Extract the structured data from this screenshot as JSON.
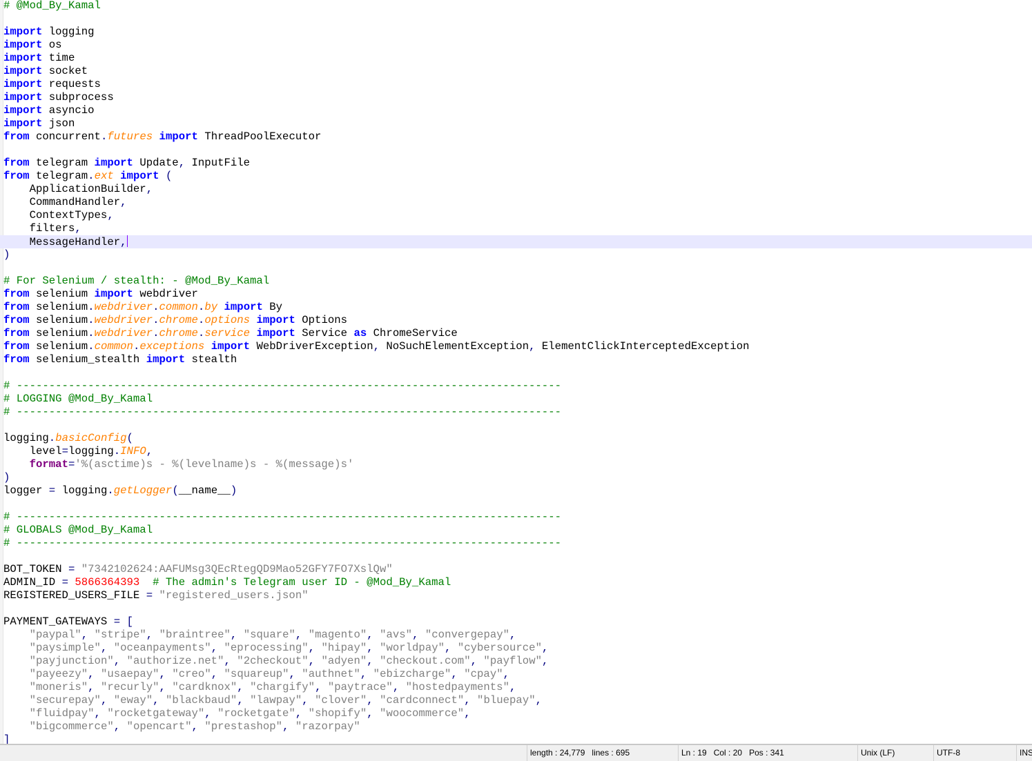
{
  "editor": {
    "current_line": 19,
    "lines": [
      [
        [
          "c",
          "# @Mod_By_Kamal"
        ]
      ],
      [],
      [
        [
          "k",
          "import"
        ],
        [
          "t",
          " logging"
        ]
      ],
      [
        [
          "k",
          "import"
        ],
        [
          "t",
          " os"
        ]
      ],
      [
        [
          "k",
          "import"
        ],
        [
          "t",
          " time"
        ]
      ],
      [
        [
          "k",
          "import"
        ],
        [
          "t",
          " socket"
        ]
      ],
      [
        [
          "k",
          "import"
        ],
        [
          "t",
          " requests"
        ]
      ],
      [
        [
          "k",
          "import"
        ],
        [
          "t",
          " subprocess"
        ]
      ],
      [
        [
          "k",
          "import"
        ],
        [
          "t",
          " asyncio"
        ]
      ],
      [
        [
          "k",
          "import"
        ],
        [
          "t",
          " json"
        ]
      ],
      [
        [
          "k",
          "from"
        ],
        [
          "t",
          " concurrent"
        ],
        [
          "o",
          "."
        ],
        [
          "a",
          "futures"
        ],
        [
          "t",
          " "
        ],
        [
          "k",
          "import"
        ],
        [
          "t",
          " ThreadPoolExecutor"
        ]
      ],
      [],
      [
        [
          "k",
          "from"
        ],
        [
          "t",
          " telegram "
        ],
        [
          "k",
          "import"
        ],
        [
          "t",
          " Update"
        ],
        [
          "o",
          ","
        ],
        [
          "t",
          " InputFile"
        ]
      ],
      [
        [
          "k",
          "from"
        ],
        [
          "t",
          " telegram"
        ],
        [
          "o",
          "."
        ],
        [
          "a",
          "ext"
        ],
        [
          "t",
          " "
        ],
        [
          "k",
          "import"
        ],
        [
          "t",
          " "
        ],
        [
          "o",
          "("
        ]
      ],
      [
        [
          "t",
          "    ApplicationBuilder"
        ],
        [
          "o",
          ","
        ]
      ],
      [
        [
          "t",
          "    CommandHandler"
        ],
        [
          "o",
          ","
        ]
      ],
      [
        [
          "t",
          "    ContextTypes"
        ],
        [
          "o",
          ","
        ]
      ],
      [
        [
          "t",
          "    filters"
        ],
        [
          "o",
          ","
        ]
      ],
      [
        [
          "t",
          "    MessageHandler"
        ],
        [
          "o",
          ","
        ]
      ],
      [
        [
          "o",
          ")"
        ]
      ],
      [],
      [
        [
          "c",
          "# For Selenium / stealth: - @Mod_By_Kamal"
        ]
      ],
      [
        [
          "k",
          "from"
        ],
        [
          "t",
          " selenium "
        ],
        [
          "k",
          "import"
        ],
        [
          "t",
          " webdriver"
        ]
      ],
      [
        [
          "k",
          "from"
        ],
        [
          "t",
          " selenium"
        ],
        [
          "o",
          "."
        ],
        [
          "a",
          "webdriver"
        ],
        [
          "o",
          "."
        ],
        [
          "a",
          "common"
        ],
        [
          "o",
          "."
        ],
        [
          "a",
          "by"
        ],
        [
          "t",
          " "
        ],
        [
          "k",
          "import"
        ],
        [
          "t",
          " By"
        ]
      ],
      [
        [
          "k",
          "from"
        ],
        [
          "t",
          " selenium"
        ],
        [
          "o",
          "."
        ],
        [
          "a",
          "webdriver"
        ],
        [
          "o",
          "."
        ],
        [
          "a",
          "chrome"
        ],
        [
          "o",
          "."
        ],
        [
          "a",
          "options"
        ],
        [
          "t",
          " "
        ],
        [
          "k",
          "import"
        ],
        [
          "t",
          " Options"
        ]
      ],
      [
        [
          "k",
          "from"
        ],
        [
          "t",
          " selenium"
        ],
        [
          "o",
          "."
        ],
        [
          "a",
          "webdriver"
        ],
        [
          "o",
          "."
        ],
        [
          "a",
          "chrome"
        ],
        [
          "o",
          "."
        ],
        [
          "a",
          "service"
        ],
        [
          "t",
          " "
        ],
        [
          "k",
          "import"
        ],
        [
          "t",
          " Service "
        ],
        [
          "k",
          "as"
        ],
        [
          "t",
          " ChromeService"
        ]
      ],
      [
        [
          "k",
          "from"
        ],
        [
          "t",
          " selenium"
        ],
        [
          "o",
          "."
        ],
        [
          "a",
          "common"
        ],
        [
          "o",
          "."
        ],
        [
          "a",
          "exceptions"
        ],
        [
          "t",
          " "
        ],
        [
          "k",
          "import"
        ],
        [
          "t",
          " WebDriverException"
        ],
        [
          "o",
          ","
        ],
        [
          "t",
          " NoSuchElementException"
        ],
        [
          "o",
          ","
        ],
        [
          "t",
          " ElementClickInterceptedException"
        ]
      ],
      [
        [
          "k",
          "from"
        ],
        [
          "t",
          " selenium_stealth "
        ],
        [
          "k",
          "import"
        ],
        [
          "t",
          " stealth"
        ]
      ],
      [],
      [
        [
          "c",
          "# ------------------------------------------------------------------------------------"
        ]
      ],
      [
        [
          "c",
          "# LOGGING @Mod_By_Kamal"
        ]
      ],
      [
        [
          "c",
          "# ------------------------------------------------------------------------------------"
        ]
      ],
      [],
      [
        [
          "t",
          "logging"
        ],
        [
          "o",
          "."
        ],
        [
          "a",
          "basicConfig"
        ],
        [
          "o",
          "("
        ]
      ],
      [
        [
          "t",
          "    level"
        ],
        [
          "o",
          "="
        ],
        [
          "t",
          "logging"
        ],
        [
          "o",
          "."
        ],
        [
          "a",
          "INFO"
        ],
        [
          "o",
          ","
        ]
      ],
      [
        [
          "t",
          "    "
        ],
        [
          "p",
          "format"
        ],
        [
          "o",
          "="
        ],
        [
          "s",
          "'%(asctime)s - %(levelname)s - %(message)s'"
        ]
      ],
      [
        [
          "o",
          ")"
        ]
      ],
      [
        [
          "t",
          "logger "
        ],
        [
          "o",
          "="
        ],
        [
          "t",
          " logging"
        ],
        [
          "o",
          "."
        ],
        [
          "a",
          "getLogger"
        ],
        [
          "o",
          "("
        ],
        [
          "t",
          "__name__"
        ],
        [
          "o",
          ")"
        ]
      ],
      [],
      [
        [
          "c",
          "# ------------------------------------------------------------------------------------"
        ]
      ],
      [
        [
          "c",
          "# GLOBALS @Mod_By_Kamal"
        ]
      ],
      [
        [
          "c",
          "# ------------------------------------------------------------------------------------"
        ]
      ],
      [],
      [
        [
          "t",
          "BOT_TOKEN "
        ],
        [
          "o",
          "="
        ],
        [
          "t",
          " "
        ],
        [
          "s",
          "\"7342102624:AAFUMsg3QEcRtegQD9Mao52GFY7FO7XslQw\""
        ]
      ],
      [
        [
          "t",
          "ADMIN_ID "
        ],
        [
          "o",
          "="
        ],
        [
          "t",
          " "
        ],
        [
          "n",
          "5866364393"
        ],
        [
          "t",
          "  "
        ],
        [
          "c",
          "# The admin's Telegram user ID - @Mod_By_Kamal"
        ]
      ],
      [
        [
          "t",
          "REGISTERED_USERS_FILE "
        ],
        [
          "o",
          "="
        ],
        [
          "t",
          " "
        ],
        [
          "s",
          "\"registered_users.json\""
        ]
      ],
      [],
      [
        [
          "t",
          "PAYMENT_GATEWAYS "
        ],
        [
          "o",
          "="
        ],
        [
          "t",
          " "
        ],
        [
          "o",
          "["
        ]
      ],
      [
        [
          "t",
          "    "
        ],
        [
          "s",
          "\"paypal\""
        ],
        [
          "o",
          ","
        ],
        [
          "t",
          " "
        ],
        [
          "s",
          "\"stripe\""
        ],
        [
          "o",
          ","
        ],
        [
          "t",
          " "
        ],
        [
          "s",
          "\"braintree\""
        ],
        [
          "o",
          ","
        ],
        [
          "t",
          " "
        ],
        [
          "s",
          "\"square\""
        ],
        [
          "o",
          ","
        ],
        [
          "t",
          " "
        ],
        [
          "s",
          "\"magento\""
        ],
        [
          "o",
          ","
        ],
        [
          "t",
          " "
        ],
        [
          "s",
          "\"avs\""
        ],
        [
          "o",
          ","
        ],
        [
          "t",
          " "
        ],
        [
          "s",
          "\"convergepay\""
        ],
        [
          "o",
          ","
        ]
      ],
      [
        [
          "t",
          "    "
        ],
        [
          "s",
          "\"paysimple\""
        ],
        [
          "o",
          ","
        ],
        [
          "t",
          " "
        ],
        [
          "s",
          "\"oceanpayments\""
        ],
        [
          "o",
          ","
        ],
        [
          "t",
          " "
        ],
        [
          "s",
          "\"eprocessing\""
        ],
        [
          "o",
          ","
        ],
        [
          "t",
          " "
        ],
        [
          "s",
          "\"hipay\""
        ],
        [
          "o",
          ","
        ],
        [
          "t",
          " "
        ],
        [
          "s",
          "\"worldpay\""
        ],
        [
          "o",
          ","
        ],
        [
          "t",
          " "
        ],
        [
          "s",
          "\"cybersource\""
        ],
        [
          "o",
          ","
        ]
      ],
      [
        [
          "t",
          "    "
        ],
        [
          "s",
          "\"payjunction\""
        ],
        [
          "o",
          ","
        ],
        [
          "t",
          " "
        ],
        [
          "s",
          "\"authorize.net\""
        ],
        [
          "o",
          ","
        ],
        [
          "t",
          " "
        ],
        [
          "s",
          "\"2checkout\""
        ],
        [
          "o",
          ","
        ],
        [
          "t",
          " "
        ],
        [
          "s",
          "\"adyen\""
        ],
        [
          "o",
          ","
        ],
        [
          "t",
          " "
        ],
        [
          "s",
          "\"checkout.com\""
        ],
        [
          "o",
          ","
        ],
        [
          "t",
          " "
        ],
        [
          "s",
          "\"payflow\""
        ],
        [
          "o",
          ","
        ]
      ],
      [
        [
          "t",
          "    "
        ],
        [
          "s",
          "\"payeezy\""
        ],
        [
          "o",
          ","
        ],
        [
          "t",
          " "
        ],
        [
          "s",
          "\"usaepay\""
        ],
        [
          "o",
          ","
        ],
        [
          "t",
          " "
        ],
        [
          "s",
          "\"creo\""
        ],
        [
          "o",
          ","
        ],
        [
          "t",
          " "
        ],
        [
          "s",
          "\"squareup\""
        ],
        [
          "o",
          ","
        ],
        [
          "t",
          " "
        ],
        [
          "s",
          "\"authnet\""
        ],
        [
          "o",
          ","
        ],
        [
          "t",
          " "
        ],
        [
          "s",
          "\"ebizcharge\""
        ],
        [
          "o",
          ","
        ],
        [
          "t",
          " "
        ],
        [
          "s",
          "\"cpay\""
        ],
        [
          "o",
          ","
        ]
      ],
      [
        [
          "t",
          "    "
        ],
        [
          "s",
          "\"moneris\""
        ],
        [
          "o",
          ","
        ],
        [
          "t",
          " "
        ],
        [
          "s",
          "\"recurly\""
        ],
        [
          "o",
          ","
        ],
        [
          "t",
          " "
        ],
        [
          "s",
          "\"cardknox\""
        ],
        [
          "o",
          ","
        ],
        [
          "t",
          " "
        ],
        [
          "s",
          "\"chargify\""
        ],
        [
          "o",
          ","
        ],
        [
          "t",
          " "
        ],
        [
          "s",
          "\"paytrace\""
        ],
        [
          "o",
          ","
        ],
        [
          "t",
          " "
        ],
        [
          "s",
          "\"hostedpayments\""
        ],
        [
          "o",
          ","
        ]
      ],
      [
        [
          "t",
          "    "
        ],
        [
          "s",
          "\"securepay\""
        ],
        [
          "o",
          ","
        ],
        [
          "t",
          " "
        ],
        [
          "s",
          "\"eway\""
        ],
        [
          "o",
          ","
        ],
        [
          "t",
          " "
        ],
        [
          "s",
          "\"blackbaud\""
        ],
        [
          "o",
          ","
        ],
        [
          "t",
          " "
        ],
        [
          "s",
          "\"lawpay\""
        ],
        [
          "o",
          ","
        ],
        [
          "t",
          " "
        ],
        [
          "s",
          "\"clover\""
        ],
        [
          "o",
          ","
        ],
        [
          "t",
          " "
        ],
        [
          "s",
          "\"cardconnect\""
        ],
        [
          "o",
          ","
        ],
        [
          "t",
          " "
        ],
        [
          "s",
          "\"bluepay\""
        ],
        [
          "o",
          ","
        ]
      ],
      [
        [
          "t",
          "    "
        ],
        [
          "s",
          "\"fluidpay\""
        ],
        [
          "o",
          ","
        ],
        [
          "t",
          " "
        ],
        [
          "s",
          "\"rocketgateway\""
        ],
        [
          "o",
          ","
        ],
        [
          "t",
          " "
        ],
        [
          "s",
          "\"rocketgate\""
        ],
        [
          "o",
          ","
        ],
        [
          "t",
          " "
        ],
        [
          "s",
          "\"shopify\""
        ],
        [
          "o",
          ","
        ],
        [
          "t",
          " "
        ],
        [
          "s",
          "\"woocommerce\""
        ],
        [
          "o",
          ","
        ]
      ],
      [
        [
          "t",
          "    "
        ],
        [
          "s",
          "\"bigcommerce\""
        ],
        [
          "o",
          ","
        ],
        [
          "t",
          " "
        ],
        [
          "s",
          "\"opencart\""
        ],
        [
          "o",
          ","
        ],
        [
          "t",
          " "
        ],
        [
          "s",
          "\"prestashop\""
        ],
        [
          "o",
          ","
        ],
        [
          "t",
          " "
        ],
        [
          "s",
          "\"razorpay\""
        ]
      ],
      [
        [
          "o",
          "]"
        ]
      ]
    ]
  },
  "statusbar": {
    "length": "length : 24,779",
    "lines": "lines : 695",
    "ln": "Ln : 19",
    "col": "Col : 20",
    "pos": "Pos : 341",
    "eol": "Unix (LF)",
    "encoding": "UTF-8",
    "mode": "INS"
  }
}
